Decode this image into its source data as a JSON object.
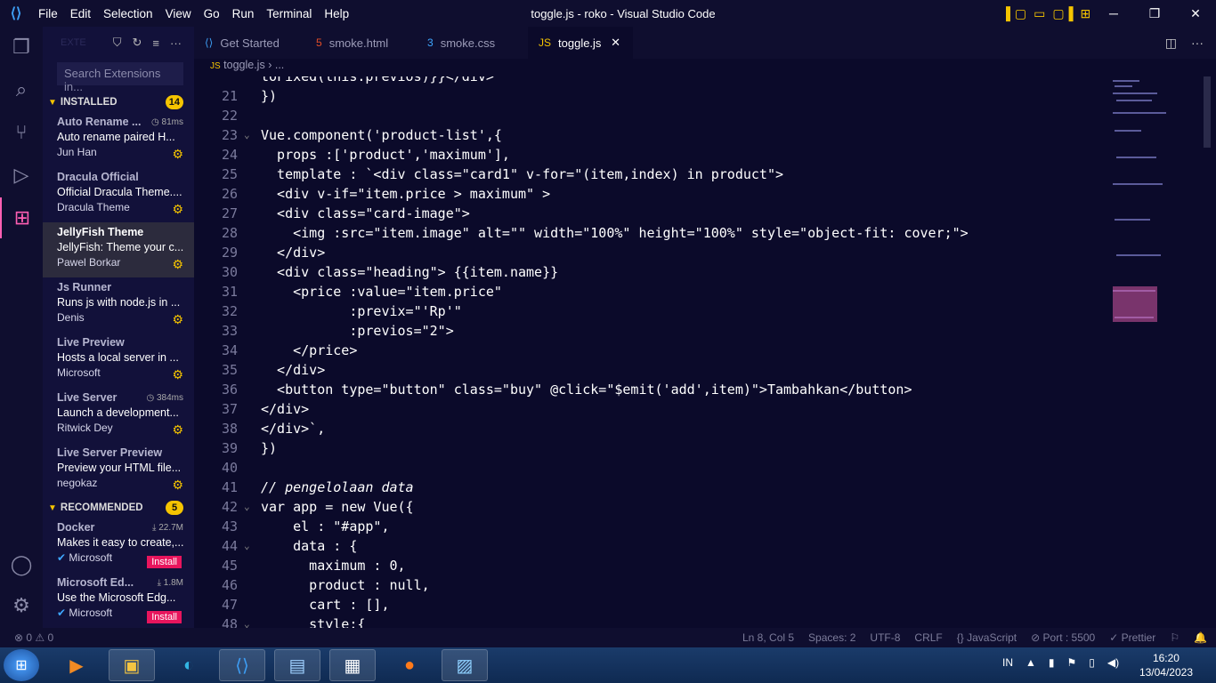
{
  "titlebar": {
    "menu": [
      "File",
      "Edit",
      "Selection",
      "View",
      "Go",
      "Run",
      "Terminal",
      "Help"
    ],
    "title": "toggle.js - roko - Visual Studio Code"
  },
  "sidebar": {
    "header_label": "EXTE",
    "search_placeholder": "Search Extensions in...",
    "installed": {
      "label": "INSTALLED",
      "count": "14"
    },
    "installed_items": [
      {
        "name": "Auto Rename ...",
        "meta": "81ms",
        "desc": "Auto rename paired H...",
        "publisher": "Jun Han"
      },
      {
        "name": "Dracula Official",
        "meta": "",
        "desc": "Official Dracula Theme....",
        "publisher": "Dracula Theme"
      },
      {
        "name": "JellyFish Theme",
        "meta": "",
        "desc": "JellyFish: Theme your c...",
        "publisher": "Pawel Borkar"
      },
      {
        "name": "Js Runner",
        "meta": "",
        "desc": "Runs js with node.js in ...",
        "publisher": "Denis"
      },
      {
        "name": "Live Preview",
        "meta": "",
        "desc": "Hosts a local server in ...",
        "publisher": "Microsoft"
      },
      {
        "name": "Live Server",
        "meta": "384ms",
        "desc": "Launch a development...",
        "publisher": "Ritwick Dey"
      },
      {
        "name": "Live Server Preview",
        "meta": "",
        "desc": "Preview your HTML file...",
        "publisher": "negokaz"
      }
    ],
    "recommended": {
      "label": "RECOMMENDED",
      "count": "5"
    },
    "recommended_items": [
      {
        "name": "Docker",
        "meta": "22.7M",
        "desc": "Makes it easy to create,...",
        "publisher": "Microsoft",
        "action": "Install"
      },
      {
        "name": "Microsoft Ed...",
        "meta": "1.8M",
        "desc": "Use the Microsoft Edg...",
        "publisher": "Microsoft",
        "action": "Install"
      }
    ]
  },
  "tabs": [
    {
      "label": "Get Started",
      "icon": "vscode-icon"
    },
    {
      "label": "smoke.html",
      "icon": "html5-icon"
    },
    {
      "label": "smoke.css",
      "icon": "css3-icon"
    },
    {
      "label": "toggle.js",
      "icon": "js-icon",
      "active": true
    }
  ],
  "breadcrumb": {
    "file": "toggle.js",
    "rest": "..."
  },
  "editor": {
    "lines": [
      {
        "n": "",
        "t": "toFixed(this.previos)}}</div>`"
      },
      {
        "n": "21",
        "t": "})"
      },
      {
        "n": "22",
        "t": ""
      },
      {
        "n": "23",
        "t": "Vue.component('product-list',{"
      },
      {
        "n": "24",
        "t": "  props :['product','maximum'],"
      },
      {
        "n": "25",
        "t": "  template : `<div class=\"card1\" v-for=\"(item,index) in product\">"
      },
      {
        "n": "26",
        "t": "  <div v-if=\"item.price > maximum\" >"
      },
      {
        "n": "27",
        "t": "  <div class=\"card-image\">"
      },
      {
        "n": "28",
        "t": "    <img :src=\"item.image\" alt=\"\" width=\"100%\" height=\"100%\" style=\"object-fit: cover;\">"
      },
      {
        "n": "29",
        "t": "  </div>"
      },
      {
        "n": "30",
        "t": "  <div class=\"heading\"> {{item.name}}"
      },
      {
        "n": "31",
        "t": "    <price :value=\"item.price\""
      },
      {
        "n": "32",
        "t": "           :previx=\"'Rp'\""
      },
      {
        "n": "33",
        "t": "           :previos=\"2\">"
      },
      {
        "n": "34",
        "t": "    </price>"
      },
      {
        "n": "35",
        "t": "  </div>"
      },
      {
        "n": "36",
        "t": "  <button type=\"button\" class=\"buy\" @click=\"$emit('add',item)\">Tambahkan</button>"
      },
      {
        "n": "37",
        "t": "</div>"
      },
      {
        "n": "38",
        "t": "</div>`,"
      },
      {
        "n": "39",
        "t": "})"
      },
      {
        "n": "40",
        "t": ""
      },
      {
        "n": "41",
        "t": "// pengelolaan data"
      },
      {
        "n": "42",
        "t": "var app = new Vue({"
      },
      {
        "n": "43",
        "t": "    el : \"#app\","
      },
      {
        "n": "44",
        "t": "    data : {"
      },
      {
        "n": "45",
        "t": "      maximum : 0,"
      },
      {
        "n": "46",
        "t": "      product : null,"
      },
      {
        "n": "47",
        "t": "      cart : [],"
      },
      {
        "n": "48",
        "t": "      style:{"
      }
    ]
  },
  "status": {
    "problems": "⊗ 0 ⚠ 0",
    "items": [
      "Ln 8, Col 5",
      "Spaces: 2",
      "UTF-8",
      "CRLF",
      "{} JavaScript",
      "⊘ Port : 5500",
      "✓ Prettier"
    ]
  },
  "taskbar": {
    "lang": "IN",
    "time": "16:20",
    "date": "13/04/2023"
  }
}
